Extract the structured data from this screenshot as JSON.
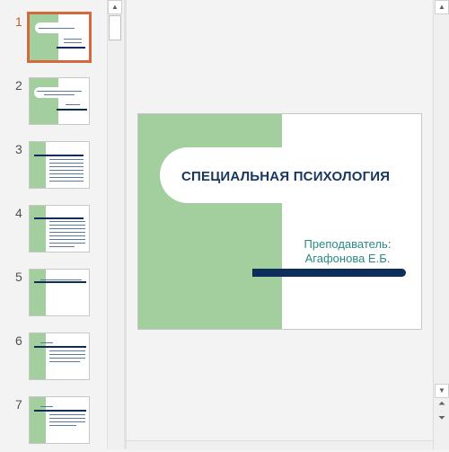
{
  "thumbnails": [
    {
      "number": "1",
      "active": true
    },
    {
      "number": "2",
      "active": false
    },
    {
      "number": "3",
      "active": false
    },
    {
      "number": "4",
      "active": false
    },
    {
      "number": "5",
      "active": false
    },
    {
      "number": "6",
      "active": false
    },
    {
      "number": "7",
      "active": false
    }
  ],
  "slide": {
    "title": "СПЕЦИАЛЬНАЯ ПСИХОЛОГИЯ",
    "subtitle_line1": "Преподаватель:",
    "subtitle_line2": "Агафонова Е.Б."
  },
  "scrollbars": {
    "up_icon": "triangle-up",
    "down_icon": "triangle-down",
    "prev_slide_icon": "double-chevron-up",
    "next_slide_icon": "double-chevron-down"
  },
  "colors": {
    "green": "#a3cf9e",
    "navy": "#0d2e5a",
    "title": "#17375e",
    "teal": "#2a8a86",
    "selection": "#d2693f"
  }
}
